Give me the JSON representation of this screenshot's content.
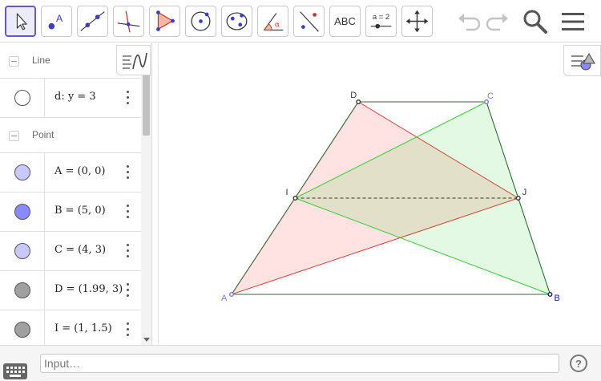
{
  "toolbar": {
    "tools": [
      {
        "name": "move-tool",
        "icon": "arrow-cursor-icon"
      },
      {
        "name": "point-tool",
        "icon": "point-icon",
        "label": "A"
      },
      {
        "name": "line-tool",
        "icon": "line-icon"
      },
      {
        "name": "perpendicular-tool",
        "icon": "perpendicular-line-icon"
      },
      {
        "name": "polygon-tool",
        "icon": "polygon-icon"
      },
      {
        "name": "circle-tool",
        "icon": "circle-center-icon"
      },
      {
        "name": "ellipse-tool",
        "icon": "ellipse-icon"
      },
      {
        "name": "angle-tool",
        "icon": "angle-icon",
        "label": "α"
      },
      {
        "name": "reflect-tool",
        "icon": "reflect-line-icon"
      },
      {
        "name": "text-tool",
        "icon": "text-icon",
        "label": "ABC"
      },
      {
        "name": "slider-tool",
        "icon": "slider-icon",
        "label": "a = 2"
      },
      {
        "name": "move-view-tool",
        "icon": "move-graphics-icon"
      }
    ],
    "undo_icon": "undo-icon",
    "redo_icon": "redo-icon",
    "search_icon": "search-icon",
    "menu_icon": "hamburger-menu-icon"
  },
  "algebra": {
    "groups": [
      {
        "name": "Line",
        "items": [
          {
            "label": "d: y = 3",
            "color": "#ffffff"
          }
        ]
      },
      {
        "name": "Point",
        "items": [
          {
            "label": "A = (0, 0)",
            "color": "#c8c8ff"
          },
          {
            "label": "B = (5, 0)",
            "color": "#8a8aff"
          },
          {
            "label": "C = (4, 3)",
            "color": "#c8c8ff"
          },
          {
            "label": "D = (1.99, 3)",
            "color": "#a0a0a0"
          },
          {
            "label": "I = (1, 1.5)",
            "color": "#a0a0a0"
          }
        ]
      }
    ]
  },
  "graphics": {
    "points": [
      {
        "name": "A",
        "x": 0,
        "y": 0,
        "color": "#7b7bd8"
      },
      {
        "name": "B",
        "x": 5,
        "y": 0,
        "color": "#1a1a80"
      },
      {
        "name": "C",
        "x": 4,
        "y": 3,
        "color": "#7b7bd8"
      },
      {
        "name": "D",
        "x": 1.99,
        "y": 3,
        "color": "#333333"
      },
      {
        "name": "I",
        "x": 1,
        "y": 1.5,
        "color": "#333333"
      },
      {
        "name": "J",
        "x": 4.5,
        "y": 1.5,
        "color": "#333333"
      }
    ],
    "colors": {
      "red_triangle_fill": "#ff0000",
      "red_triangle_stroke": "#e53935",
      "green_triangle_fill": "#00cc00",
      "green_triangle_stroke": "#33cc33",
      "trapezoid_stroke": "#2f6b3a",
      "dashed_segment": "#333333"
    }
  },
  "input": {
    "placeholder": "Input…"
  },
  "help_label": "?"
}
